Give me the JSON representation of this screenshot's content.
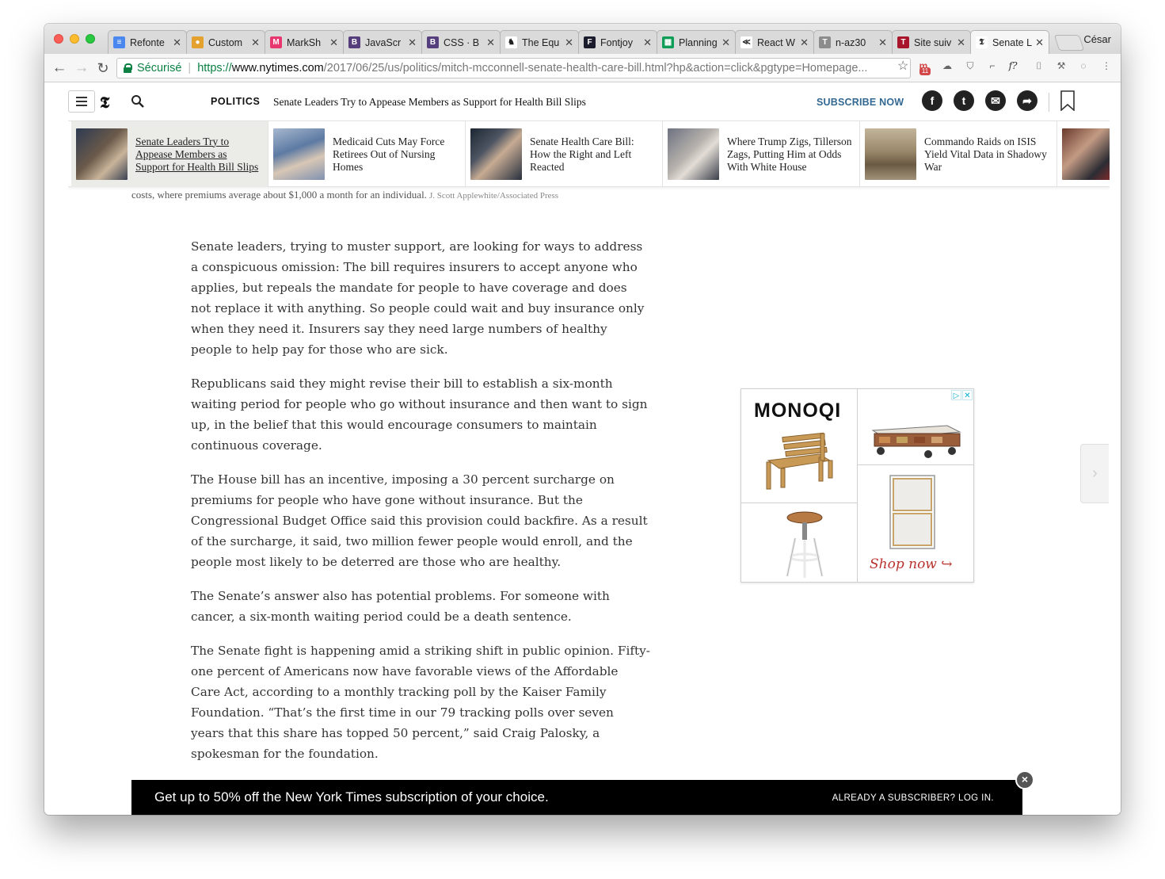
{
  "browser": {
    "profile_name": "César",
    "tabs": [
      {
        "title": "Refonte",
        "favicon": "docs-icon",
        "color": "#4a88f0",
        "glyph": "≡"
      },
      {
        "title": "Custom",
        "favicon": "chrome-web-store-icon",
        "color": "#e5a12d",
        "glyph": "●"
      },
      {
        "title": "MarkSh",
        "favicon": "marksheet-icon",
        "color": "#e8366f",
        "glyph": "M"
      },
      {
        "title": "JavaScr",
        "favicon": "bootstrap-icon",
        "color": "#563d7c",
        "glyph": "B"
      },
      {
        "title": "CSS · B",
        "favicon": "bootstrap-icon",
        "color": "#563d7c",
        "glyph": "B"
      },
      {
        "title": "The Equ",
        "favicon": "people-icon",
        "color": "#ffffff",
        "glyph": "♞"
      },
      {
        "title": "Fontjoy",
        "favicon": "fontjoy-icon",
        "color": "#1b1b2e",
        "glyph": "F"
      },
      {
        "title": "Planning",
        "favicon": "sheets-icon",
        "color": "#0f9d58",
        "glyph": "▦"
      },
      {
        "title": "React W",
        "favicon": "react-w-icon",
        "color": "#ffffff",
        "glyph": "≪"
      },
      {
        "title": "n-az30",
        "favicon": "t-grey-icon",
        "color": "#8c8c8c",
        "glyph": "T"
      },
      {
        "title": "Site suiv",
        "favicon": "t-red-icon",
        "color": "#a8152b",
        "glyph": "T"
      },
      {
        "title": "Senate L",
        "favicon": "nyt-icon",
        "color": "#ffffff",
        "glyph": "𝕿",
        "active": true
      }
    ],
    "address": {
      "secure_label": "Sécurisé",
      "scheme": "https://",
      "host": "www.nytimes.com",
      "path": "/2017/06/25/us/politics/mitch-mcconnell-senate-health-care-bill.html?hp&action=click&pgtype=Homepage..."
    },
    "extensions": [
      {
        "name": "gmail-badge-icon",
        "glyph": "m",
        "badge": "11"
      },
      {
        "name": "cloud-icon",
        "glyph": "☁"
      },
      {
        "name": "shield-icon",
        "glyph": "⛉"
      },
      {
        "name": "bookmark-ext-icon",
        "glyph": "⌐"
      },
      {
        "name": "font-ext-icon",
        "glyph": "f?"
      },
      {
        "name": "camera-icon",
        "glyph": "⌷"
      },
      {
        "name": "tools-icon",
        "glyph": "⚒"
      },
      {
        "name": "colorful-ring-icon",
        "glyph": "◌"
      },
      {
        "name": "more-vert-icon",
        "glyph": "⋮"
      }
    ]
  },
  "nyt_bar": {
    "logo": "𝕿",
    "section": "POLITICS",
    "headline": "Senate Leaders Try to Appease Members as Support for Health Bill Slips",
    "subscribe": "SUBSCRIBE NOW",
    "share_icons": [
      "facebook-icon",
      "twitter-icon",
      "email-icon",
      "share-icon"
    ]
  },
  "rail": [
    {
      "title": "Senate Leaders Try to Appease Members as Support for Health Bill Slips",
      "active": true
    },
    {
      "title": "Medicaid Cuts May Force Retirees Out of Nursing Homes"
    },
    {
      "title": "Senate Health Care Bill: How the Right and Left Reacted"
    },
    {
      "title": "Where Trump Zigs, Tillerson Zags, Putting Him at Odds With White House"
    },
    {
      "title": "Commando Raids on ISIS Yield Vital Data in Shadowy War"
    },
    {
      "title": ""
    }
  ],
  "caption": {
    "text": "costs, where premiums average about $1,000 a month for an individual.",
    "credit": "J. Scott Applewhite/Associated Press"
  },
  "article": {
    "paragraphs": [
      "Senate leaders, trying to muster support, are looking for ways to address a conspicuous omission: The bill requires insurers to accept anyone who applies, but repeals the mandate for people to have coverage and does not replace it with anything. So people could wait and buy insurance only when they need it. Insurers say they need large numbers of healthy people to help pay for those who are sick.",
      "Republicans said they might revise their bill to establish a six-month waiting period for people who go without insurance and then want to sign up, in the belief that this would encourage consumers to maintain continuous coverage.",
      "The House bill has an incentive, imposing a 30 percent surcharge on premiums for people who have gone without insurance. But the Congressional Budget Office said this provision could backfire. As a result of the surcharge, it said, two million fewer people would enroll, and the people most likely to be deterred are those who are healthy.",
      "The Senate’s answer also has potential problems. For someone with cancer, a six-month waiting period could be a death sentence.",
      "The Senate fight is happening amid a striking shift in public opinion. Fifty-one percent of Americans now have favorable views of the Affordable Care Act, according to a monthly tracking poll by the Kaiser Family Foundation. “That’s the first time in our 79 tracking polls over seven years that this share has topped 50 percent,” said Craig Palosky, a spokesman for the foundation."
    ]
  },
  "ad": {
    "brand": "MONOQI",
    "cta": "Shop now ↪"
  },
  "promo": {
    "text": "Get up to 50% off the New York Times subscription of your choice.",
    "login": "ALREADY A SUBSCRIBER? LOG IN."
  }
}
